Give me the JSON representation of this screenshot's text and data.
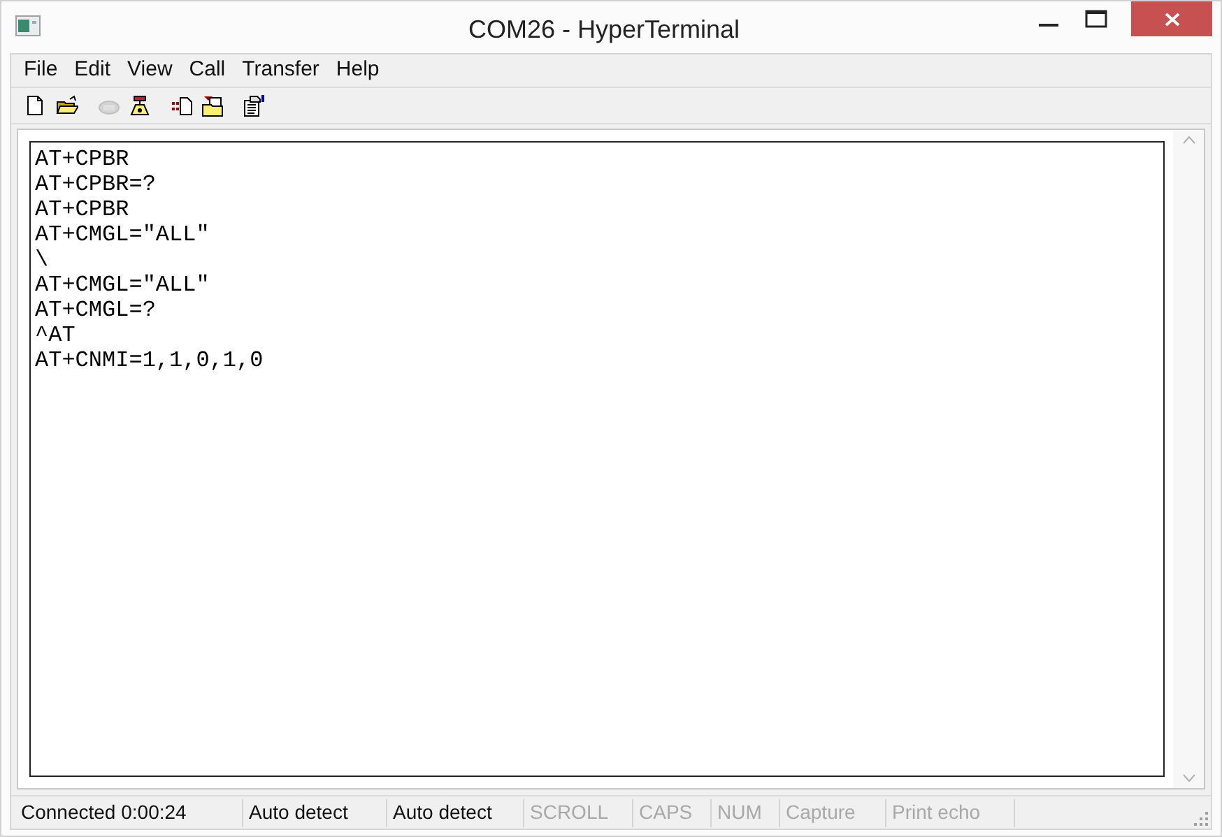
{
  "window": {
    "title": "COM26 - HyperTerminal"
  },
  "menu": [
    "File",
    "Edit",
    "View",
    "Call",
    "Transfer",
    "Help"
  ],
  "toolbar": [
    {
      "kind": "new",
      "disabled": false
    },
    {
      "kind": "open",
      "disabled": false
    },
    {
      "kind": "disconnect",
      "disabled": true
    },
    {
      "kind": "call",
      "disabled": false
    },
    {
      "kind": "send",
      "disabled": false
    },
    {
      "kind": "receive",
      "disabled": false
    },
    {
      "kind": "properties",
      "disabled": false
    }
  ],
  "terminal": {
    "lines": [
      "AT+CPBR",
      "AT+CPBR=?",
      "AT+CPBR",
      "AT+CMGL=\"ALL\"",
      "\\",
      "AT+CMGL=\"ALL\"",
      "AT+CMGL=?",
      "^AT",
      "AT+CNMI=1,1,0,1,0"
    ]
  },
  "status_bar": [
    {
      "text": "Connected 0:00:24",
      "disabled": false
    },
    {
      "text": "Auto detect",
      "disabled": false
    },
    {
      "text": "Auto detect",
      "disabled": false
    },
    {
      "text": "SCROLL",
      "disabled": true
    },
    {
      "text": "CAPS",
      "disabled": true
    },
    {
      "text": "NUM",
      "disabled": true
    },
    {
      "text": "Capture",
      "disabled": true
    },
    {
      "text": "Print echo",
      "disabled": true
    }
  ]
}
